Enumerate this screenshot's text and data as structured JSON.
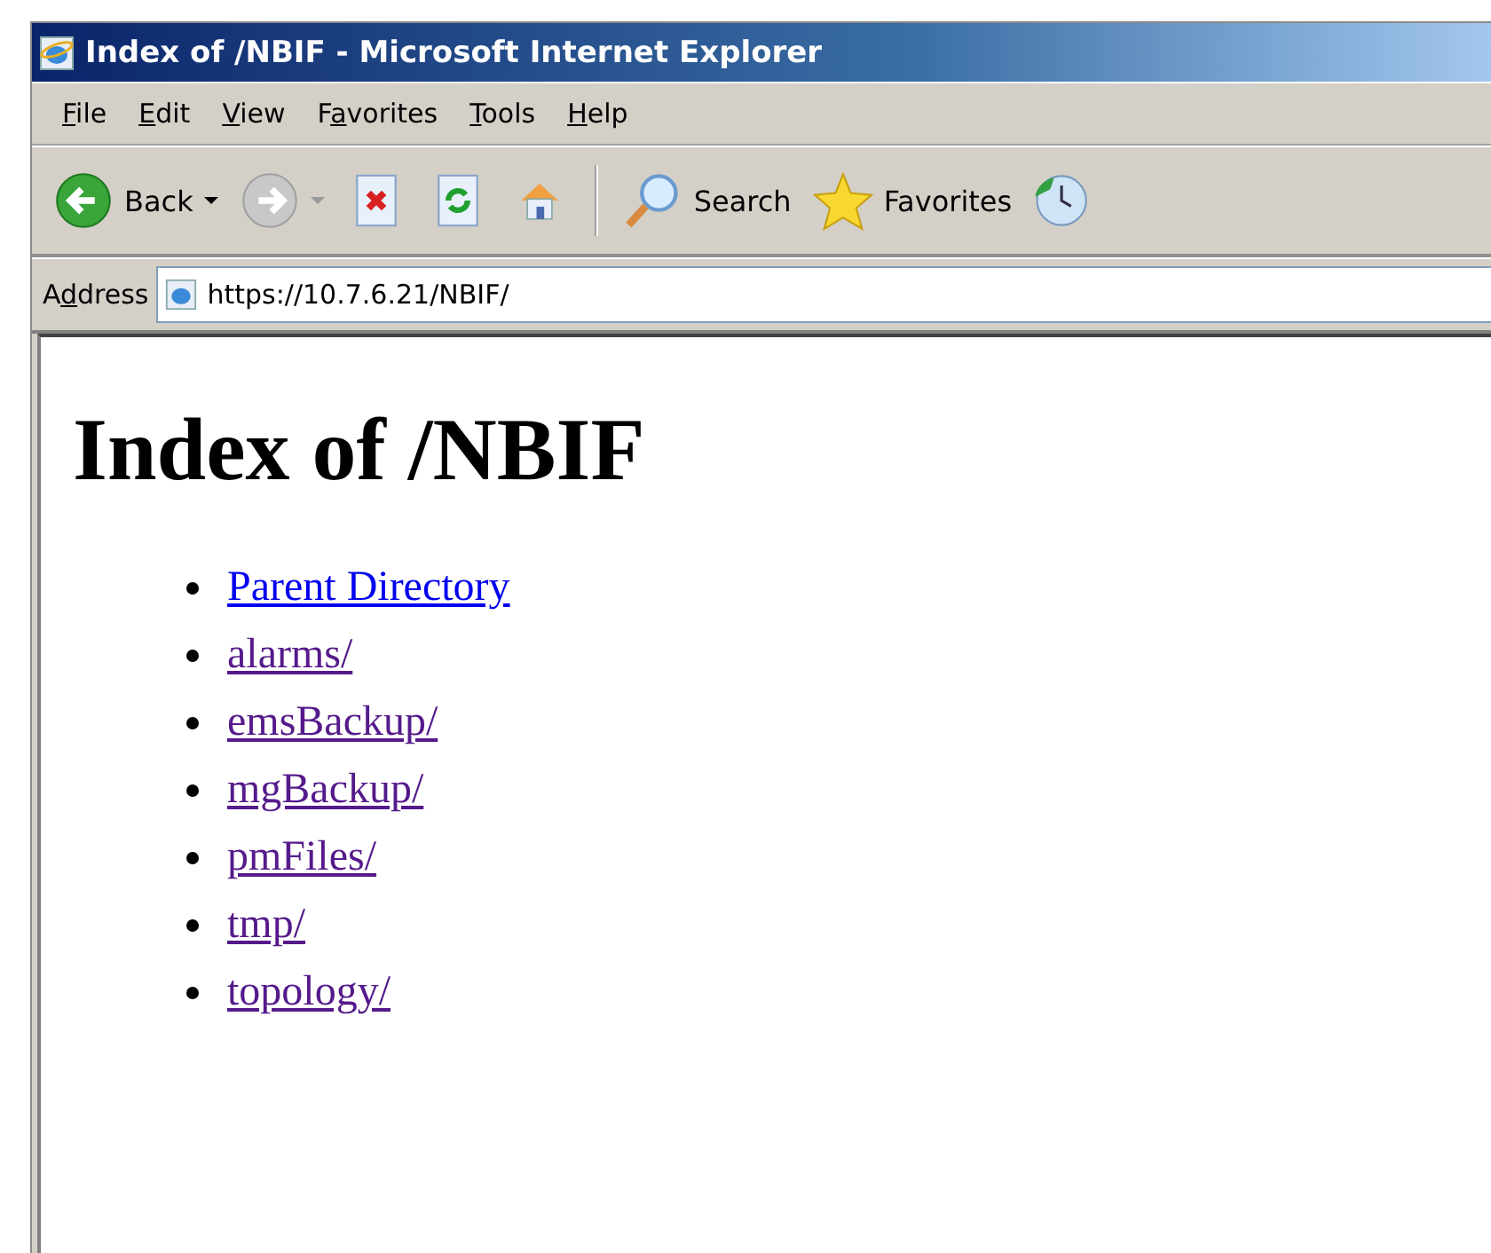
{
  "window": {
    "title": "Index of /NBIF - Microsoft Internet Explorer"
  },
  "menu": [
    {
      "label": "File"
    },
    {
      "label": "Edit"
    },
    {
      "label": "View"
    },
    {
      "label": "Favorites"
    },
    {
      "label": "Tools"
    },
    {
      "label": "Help"
    }
  ],
  "toolbar": {
    "back": "Back",
    "search": "Search",
    "favorites": "Favorites"
  },
  "address": {
    "label": "Address",
    "value": "https://10.7.6.21/NBIF/"
  },
  "page": {
    "heading": "Index of /NBIF",
    "links": [
      {
        "text": "Parent Directory",
        "visited": false
      },
      {
        "text": "alarms/",
        "visited": true
      },
      {
        "text": "emsBackup/",
        "visited": true
      },
      {
        "text": "mgBackup/",
        "visited": true
      },
      {
        "text": "pmFiles/",
        "visited": true
      },
      {
        "text": "tmp/",
        "visited": true
      },
      {
        "text": "topology/",
        "visited": true
      }
    ]
  }
}
